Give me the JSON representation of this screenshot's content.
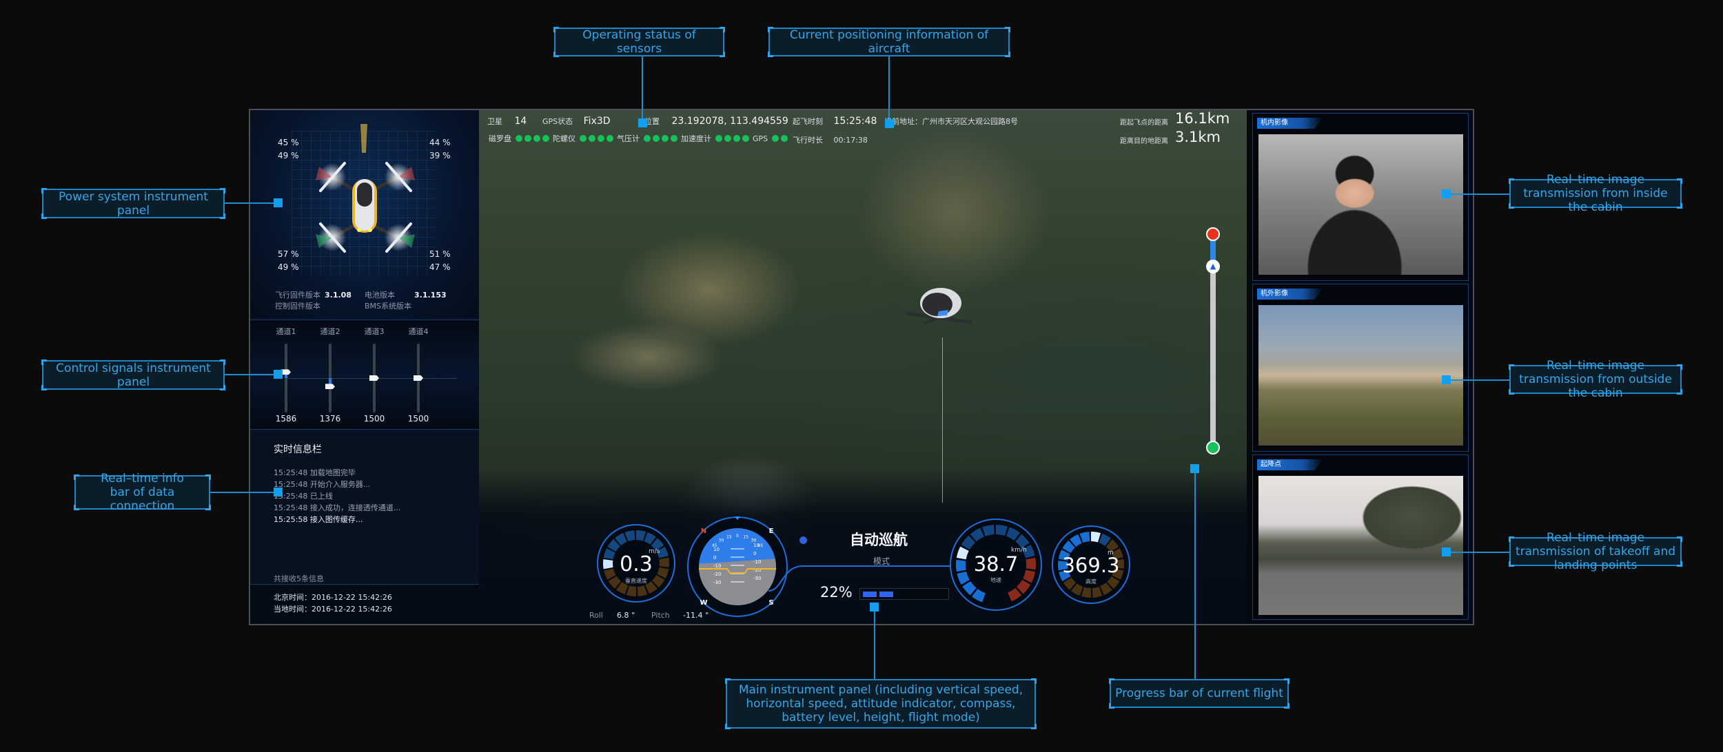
{
  "callouts": {
    "sensors": "Operating status of sensors",
    "positioning": "Current positioning information of aircraft",
    "power": "Power system instrument panel",
    "control": "Control signals instrument panel",
    "realtime_info": "Real–time info bar of data connection",
    "main_instrument": "Main instrument panel (including vertical speed, horizontal speed, attitude indicator, compass, battery level, height, flight mode)",
    "progress": "Progress bar of current flight",
    "cabin_inside": "Real–time image transmission from inside the cabin",
    "cabin_outside": "Real–time image transmission from outside the cabin",
    "takeoff_landing": "Real–time image transmission of takeoff and landing points"
  },
  "power_panel": {
    "motors": [
      {
        "position": "front-left",
        "values": [
          "45 %",
          "49 %"
        ],
        "glow": "#c0444a"
      },
      {
        "position": "front-right",
        "values": [
          "44 %",
          "39 %"
        ],
        "glow": "#c0444a"
      },
      {
        "position": "rear-left",
        "values": [
          "57 %",
          "49 %"
        ],
        "glow": "#2aa861"
      },
      {
        "position": "rear-right",
        "values": [
          "51 %",
          "47 %"
        ],
        "glow": "#2aa861"
      }
    ],
    "versions": [
      {
        "label": "飞行固件版本",
        "value": "3.1.08"
      },
      {
        "label": "电池版本",
        "value": "3.1.153"
      },
      {
        "label": "控制固件版本",
        "value": ""
      },
      {
        "label": "BMS系统版本",
        "value": ""
      }
    ]
  },
  "control_panel": {
    "channels": [
      {
        "label": "通道1",
        "value": "1586",
        "fraction": 0.586
      },
      {
        "label": "通道2",
        "value": "1376",
        "fraction": 0.376
      },
      {
        "label": "通道3",
        "value": "1500",
        "fraction": 0.5
      },
      {
        "label": "通道4",
        "value": "1500",
        "fraction": 0.5
      }
    ]
  },
  "info_bar": {
    "title": "实时信息栏",
    "lines": [
      "15:25:48 加载地图完毕",
      "15:25:48 开始介入服务器...",
      "15:25:48 已上线",
      "15:25:48 接入成功，连接透传通道...",
      "15:25:58 接入图传缓存..."
    ],
    "count": "共接收5条信息",
    "beijing_time": "北京时间：2016-12-22 15:42:26",
    "local_time": "当地时间：2016-12-22 15:42:26"
  },
  "hud": {
    "satellites_label": "卫星",
    "satellites": "14",
    "gps_status_label": "GPS状态",
    "gps_status": "Fix3D",
    "position_label": "位置",
    "position": "23.192078, 113.494559",
    "takeoff_time_label": "起飞时刻",
    "takeoff_time": "15:25:48",
    "address_label": "当前地址：",
    "address": "广州市天河区大观公园路8号",
    "flight_duration_label": "飞行时长",
    "flight_duration": "00:17:38",
    "dist_from_start_label": "距起飞点的距离",
    "dist_from_start": "16.1km",
    "dist_to_dest_label": "距离目的地距离",
    "dist_to_dest": "3.1km",
    "sensors": [
      {
        "name": "磁罗盘",
        "ok_count": 4,
        "color": "#16c35a"
      },
      {
        "name": "陀螺仪",
        "ok_count": 4,
        "color": "#16c35a"
      },
      {
        "name": "气压计",
        "ok_count": 4,
        "color": "#16c35a"
      },
      {
        "name": "加速度计",
        "ok_count": 4,
        "color": "#16c35a"
      },
      {
        "name": "GPS",
        "ok_count": 2,
        "color": "#16c35a"
      }
    ]
  },
  "flight_progress": {
    "fraction": 0.85,
    "start_color": "#16c35a",
    "end_color": "#e8321e"
  },
  "instruments": {
    "vertical_speed": {
      "value": "0.3",
      "unit": "m/s",
      "caption": "垂直速度"
    },
    "horizontal_speed": {
      "value": "38.7",
      "unit": "km/h",
      "caption": "地速"
    },
    "altitude": {
      "value": "369.3",
      "unit": "m",
      "caption": "高度"
    },
    "attitude": {
      "roll_label": "Roll",
      "roll": "6.8 °",
      "pitch_label": "Pitch",
      "pitch": "-11.4 °",
      "compass": [
        "N",
        "E",
        "S",
        "W"
      ],
      "bank_scale": [
        "45",
        "30",
        "15",
        "0",
        "15",
        "30",
        "45"
      ],
      "pitch_scale_left": [
        "10",
        "0",
        "-10",
        "-20",
        "-30"
      ],
      "pitch_scale_right": [
        "10",
        "0",
        "-10",
        "-20",
        "-30"
      ]
    },
    "flight_mode": {
      "title": "自动巡航",
      "subtitle": "模式"
    },
    "battery": {
      "percent_label": "22%",
      "fraction": 0.22
    }
  },
  "videos": [
    {
      "tag": "机内影像"
    },
    {
      "tag": "机外影像"
    },
    {
      "tag": "起降点"
    }
  ],
  "colors": {
    "accent": "#1a8fd6",
    "callout_text": "#35a6e8",
    "ok": "#16c35a",
    "warning_arc": "#a0301e"
  }
}
